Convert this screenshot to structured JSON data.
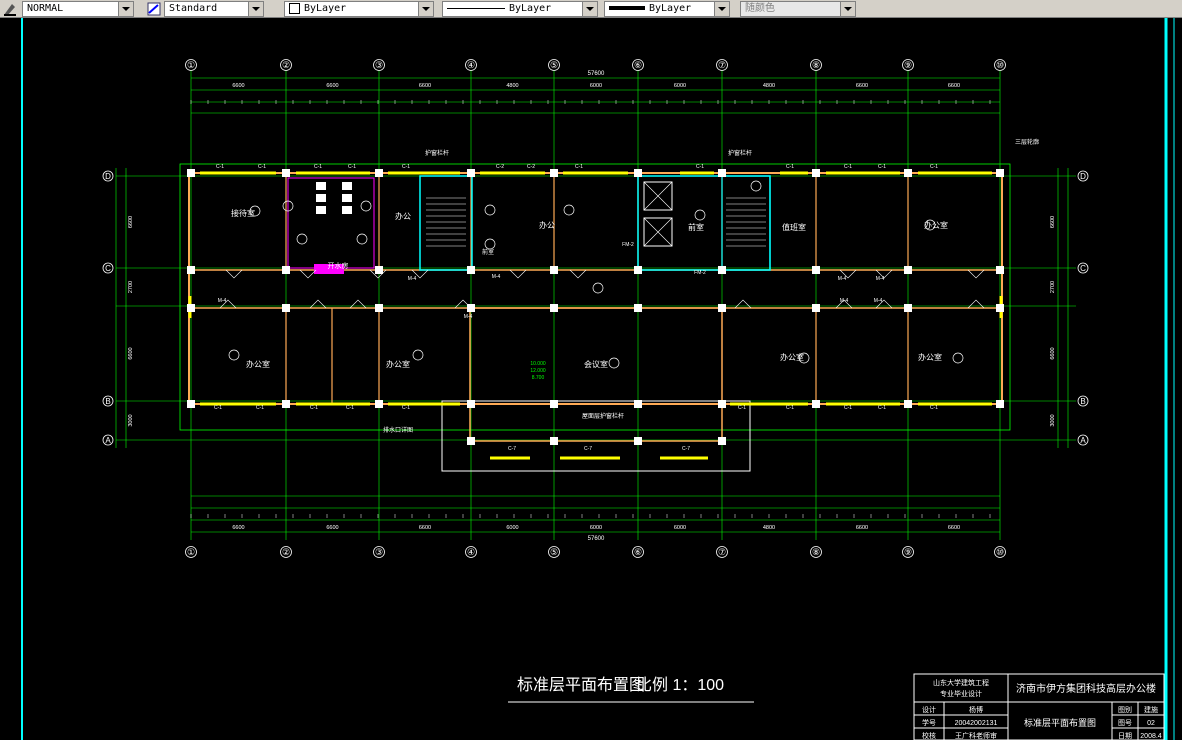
{
  "toolbar": {
    "text_style": "NORMAL",
    "dim_style": "Standard",
    "layer": "ByLayer",
    "linetype": "ByLayer",
    "lineweight": "ByLayer",
    "plot_style": "随颜色"
  },
  "axes": {
    "numbers": [
      "①",
      "②",
      "③",
      "④",
      "⑤",
      "⑥",
      "⑦",
      "⑧",
      "⑨",
      "⑩"
    ],
    "letters": [
      "A",
      "B",
      "C",
      "D"
    ],
    "overall_width": "57600",
    "bays_top": [
      "6600",
      "6600",
      "6600",
      "4800",
      "6000",
      "6000",
      "4800",
      "6600",
      "6600"
    ],
    "bays_bottom": [
      "6600",
      "6600",
      "6600",
      "6000",
      "6000",
      "6000",
      "4800",
      "6600",
      "6600"
    ],
    "row_dims": [
      "3000",
      "6600",
      "2700",
      "6600"
    ]
  },
  "rooms": {
    "office": "办公室",
    "office_short": "办公",
    "reception": "接待室",
    "water_room": "开水房",
    "elevator_hall": "前室",
    "meeting_room": "会议室",
    "duty_room": "值班室",
    "handrail": "护窗栏杆",
    "roof_rail": "屋面层护窗栏杆",
    "outline_note": "三层轮廓",
    "detail_note": "排水口详图",
    "elev_labels": [
      "10.000",
      "12.000",
      "8.700"
    ]
  },
  "openings": {
    "window": "C-1",
    "window2": "C-2",
    "window7": "C-7",
    "door": "M-4",
    "door_fire": "FM-2"
  },
  "title": {
    "main": "标准层平面布置图",
    "scale": "比例 1：100"
  },
  "titleblock": {
    "school": "山东大学建筑工程",
    "school_sub": "专业毕业设计",
    "project": "济南市伊方集团科技高层办公楼",
    "drawing_name": "标准层平面布置图",
    "labels": [
      "设计",
      "学号",
      "校核",
      "图别",
      "图号",
      "日期"
    ],
    "values": [
      "杨博",
      "20042002131",
      "王广科老师审",
      "建施",
      "02",
      "2008.4"
    ]
  },
  "colors": {
    "axis": "#00ff00",
    "wall": "#ffaa55",
    "column": "#ffffff",
    "window": "#ffff00",
    "core": "#00ffff",
    "purple": "#ff00ff"
  }
}
